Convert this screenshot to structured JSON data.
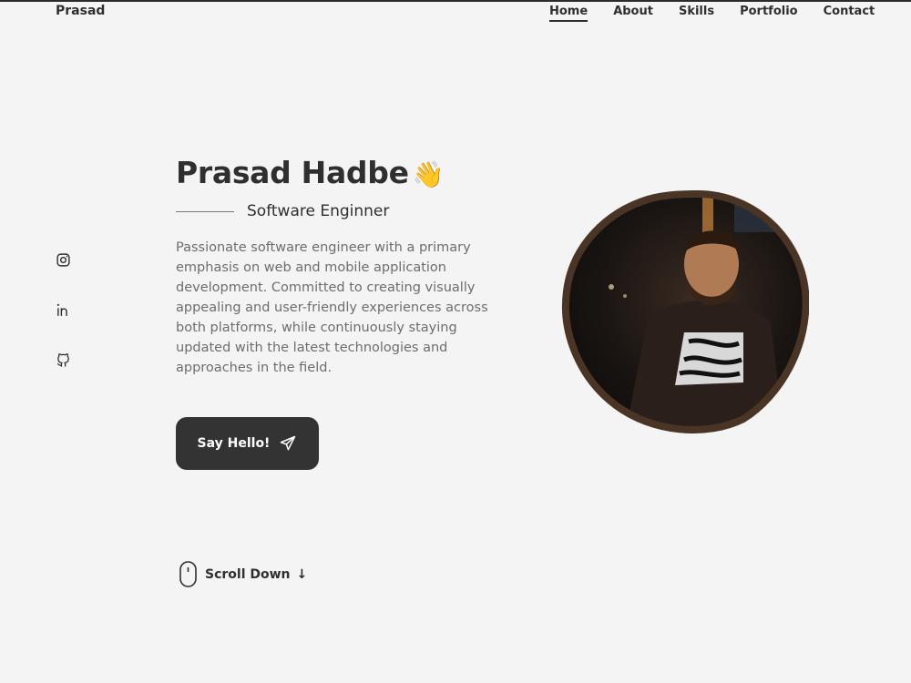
{
  "header": {
    "brand": "Prasad",
    "nav": [
      {
        "label": "Home",
        "active": true
      },
      {
        "label": "About",
        "active": false
      },
      {
        "label": "Skills",
        "active": false
      },
      {
        "label": "Portfolio",
        "active": false
      },
      {
        "label": "Contact",
        "active": false
      }
    ]
  },
  "hero": {
    "name": "Prasad Hadbe",
    "wave_emoji": "👋",
    "subtitle": "Software Enginner",
    "description": "Passionate software engineer with a primary emphasis on web and mobile application development. Committed to creating visually appealing and user-friendly experiences across both platforms, while continuously staying updated with the latest technologies and approaches in the field.",
    "cta_label": "Say Hello!"
  },
  "socials": [
    "instagram-icon",
    "linkedin-icon",
    "github-icon"
  ],
  "scroll": {
    "label": "Scroll Down",
    "arrow": "↓"
  },
  "colors": {
    "background": "#f4f4f4",
    "text": "#2f2f2f",
    "button": "#333333",
    "blob_border": "#4a3426"
  }
}
